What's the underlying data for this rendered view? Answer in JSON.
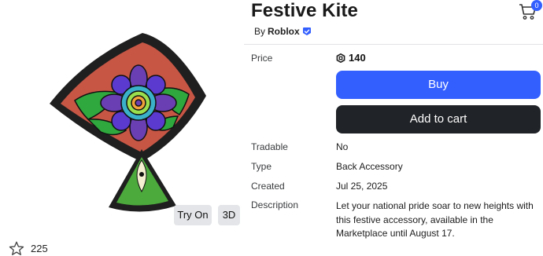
{
  "item": {
    "name": "Festive Kite",
    "by_prefix": "By",
    "creator": "Roblox",
    "creator_verified": true,
    "favorite_count": "225"
  },
  "preview": {
    "try_on_label": "Try On",
    "view_3d_label": "3D"
  },
  "cart": {
    "count": "0",
    "icon": "cart-icon"
  },
  "purchase": {
    "price_label": "Price",
    "price_value": "140",
    "currency_icon": "robux-icon",
    "buy_label": "Buy",
    "add_to_cart_label": "Add to cart"
  },
  "details": {
    "tradable_label": "Tradable",
    "tradable_value": "No",
    "type_label": "Type",
    "type_value": "Back Accessory",
    "created_label": "Created",
    "created_value": "Jul 25, 2025",
    "description_label": "Description",
    "description_value": "Let your national pride soar to new heights with this festive accessory, available in the Marketplace until August 17."
  },
  "colors": {
    "brand_blue": "#335fff",
    "dark_button": "#202327",
    "pill_bg": "#e3e5e8",
    "kite_red": "#c75645",
    "kite_border": "#1e1e1e",
    "kite_green": "#2fa83d",
    "kite_purple": "#6a3fb3"
  }
}
